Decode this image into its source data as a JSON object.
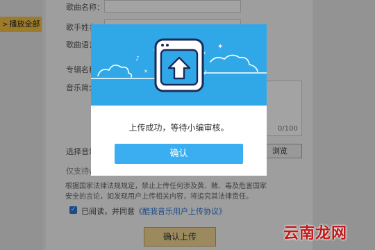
{
  "sidebar": {
    "play_all_label": "播放全部"
  },
  "form": {
    "song_name_label": "歌曲名称：",
    "singer_label": "歌手姓名",
    "language_label": "歌曲语言",
    "album_label": "专辑名称",
    "intro_label": "音乐简介",
    "intro_counter": "0/100",
    "select_label": "选择音乐",
    "browse_label": "浏览",
    "support_label": "仅支持w",
    "notice": "根据国家法律法规规定，禁止上传任何涉及黄、赌、毒及危害国家安全的言论，如发现用户上传相关内容，将追究其法律责任。",
    "agree_prefix": "已阅读，并同意",
    "agree_link": "《酷我音乐用户上传协议》",
    "submit_label": "确认上传"
  },
  "dialog": {
    "message": "上传成功，等待小编审核。",
    "confirm_label": "确认"
  },
  "watermark": "云南龙网",
  "colors": {
    "dialog_header": "#30a8e8",
    "confirm_button": "#3aaef0",
    "play_all_bg": "#f5c343",
    "watermark": "#c01818"
  },
  "icons": {
    "upload": "upload-icon",
    "checkbox": "checkbox-checked-icon",
    "play_arrow": "play-arrow-icon"
  }
}
